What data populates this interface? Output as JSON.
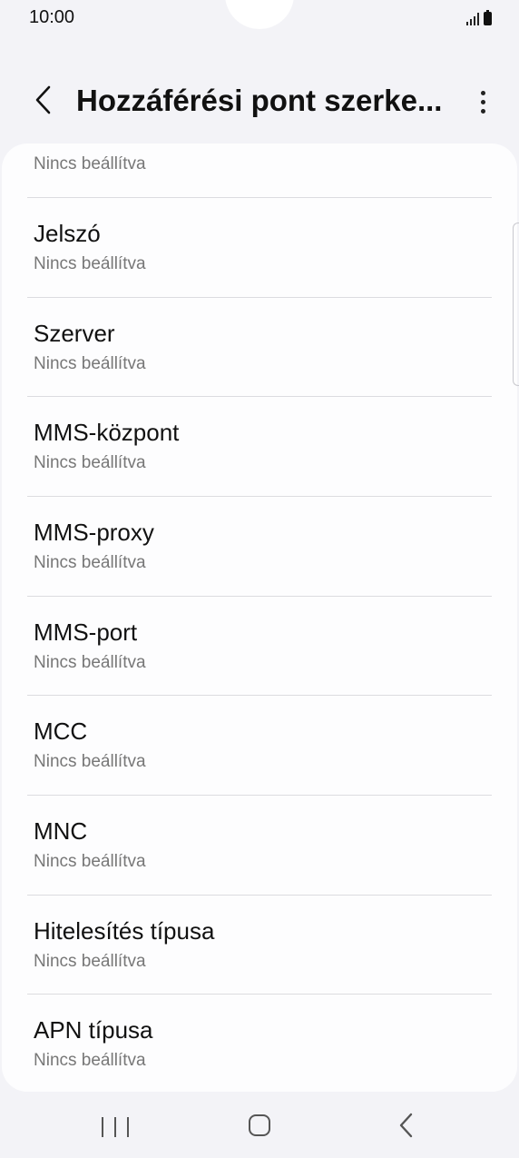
{
  "status_bar": {
    "time": "10:00"
  },
  "header": {
    "title": "Hozzáférési pont szerke...",
    "back_icon": "chevron-left-icon",
    "more_icon": "more-vertical-icon"
  },
  "list": {
    "cut_off_subtitle": "Nincs beállítva",
    "items": [
      {
        "title": "Jelszó",
        "subtitle": "Nincs beállítva"
      },
      {
        "title": "Szerver",
        "subtitle": "Nincs beállítva"
      },
      {
        "title": "MMS-központ",
        "subtitle": "Nincs beállítva"
      },
      {
        "title": "MMS-proxy",
        "subtitle": "Nincs beállítva"
      },
      {
        "title": "MMS-port",
        "subtitle": "Nincs beállítva"
      },
      {
        "title": "MCC",
        "subtitle": "Nincs beállítva"
      },
      {
        "title": "MNC",
        "subtitle": "Nincs beállítva"
      },
      {
        "title": "Hitelesítés típusa",
        "subtitle": "Nincs beállítva"
      },
      {
        "title": "APN típusa",
        "subtitle": "Nincs beállítva"
      }
    ]
  },
  "nav_bar": {
    "recent_icon": "recent-apps-icon",
    "home_icon": "home-icon",
    "back_icon": "back-icon"
  },
  "colors": {
    "background": "#f3f3f7",
    "card": "#fdfdfe",
    "title_text": "#111111",
    "subtitle_text": "#777777",
    "divider": "#dcdce0"
  }
}
